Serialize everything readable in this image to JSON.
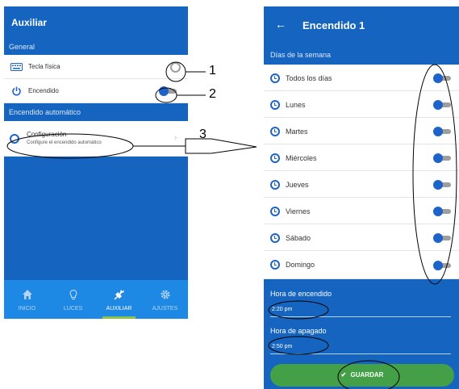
{
  "left_screen": {
    "title": "Auxiliar",
    "section_general": "General",
    "tecla": {
      "label": "Tecla física",
      "icon": "keyboard-icon"
    },
    "encendido": {
      "label": "Encendido",
      "icon": "power-icon",
      "state": "on"
    },
    "section_auto": "Encendido automático",
    "config": {
      "title": "Configuración",
      "subtitle": "Configure el encendido automático",
      "icon": "clock-icon"
    },
    "nav": [
      {
        "label": "INICIO",
        "icon": "home-icon",
        "active": false
      },
      {
        "label": "LUCES",
        "icon": "bulb-icon",
        "active": false
      },
      {
        "label": "AUXILIAR",
        "icon": "plug-icon",
        "active": true
      },
      {
        "label": "AJUSTES",
        "icon": "gear-icon",
        "active": false
      }
    ]
  },
  "right_screen": {
    "title": "Encendido 1",
    "section_days": "Días de la semana",
    "days": [
      {
        "label": "Todos los días",
        "state": "on"
      },
      {
        "label": "Lunes",
        "state": "on"
      },
      {
        "label": "Martes",
        "state": "on"
      },
      {
        "label": "Miércoles",
        "state": "on"
      },
      {
        "label": "Jueves",
        "state": "on"
      },
      {
        "label": "Viernes",
        "state": "on"
      },
      {
        "label": "Sábado",
        "state": "on"
      },
      {
        "label": "Domingo",
        "state": "on"
      }
    ],
    "on_time": {
      "label": "Hora de encendido",
      "value": "2:20 pm"
    },
    "off_time": {
      "label": "Hora de apagado",
      "value": "2:50 pm"
    },
    "save_label": "GUARDAR"
  },
  "callouts": {
    "c1": "1",
    "c2": "2",
    "c3": "3"
  },
  "colors": {
    "primary": "#1565c0",
    "nav": "#1e88e5",
    "accent": "#1e63c9",
    "save": "#43a047",
    "active_tab": "#8bc34a"
  }
}
